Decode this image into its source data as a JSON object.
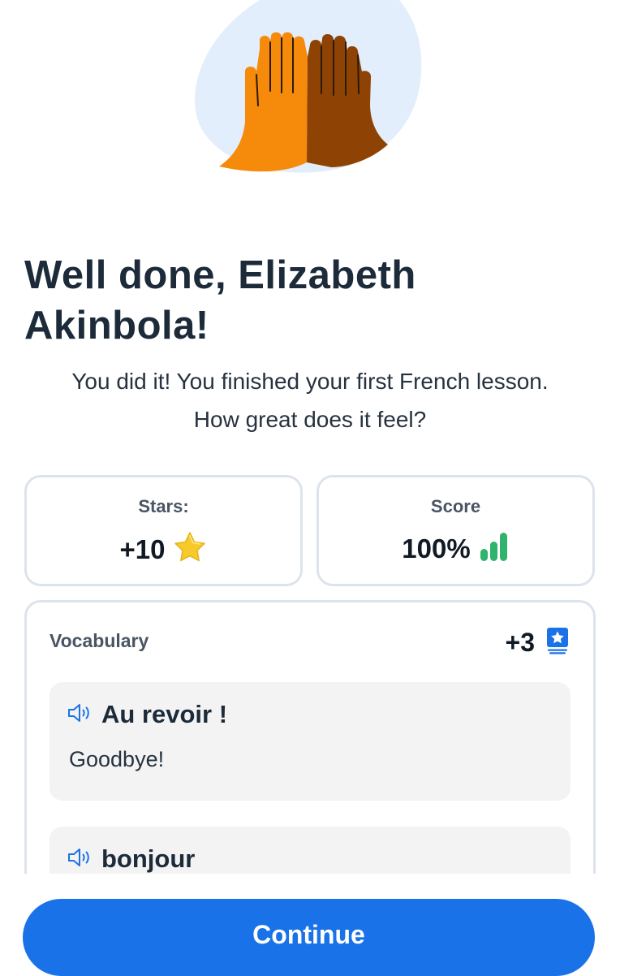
{
  "header": {
    "title": "Well done, Elizabeth Akinbola!",
    "subtitle": "You did it! You finished your first French lesson. How great does it feel?"
  },
  "stats": {
    "stars": {
      "label": "Stars:",
      "value": "+10",
      "icon": "star-icon",
      "icon_color": "#f7c92b"
    },
    "score": {
      "label": "Score",
      "value": "100%",
      "icon": "signal-bars-icon",
      "icon_color": "#2fb36d"
    }
  },
  "vocabulary": {
    "title": "Vocabulary",
    "count": "+3",
    "count_icon": "flashcards-star-icon",
    "items": [
      {
        "word": "Au revoir !",
        "translation": "Goodbye!",
        "icon": "speaker-icon"
      },
      {
        "word": "bonjour",
        "icon": "speaker-icon"
      }
    ]
  },
  "actions": {
    "continue_label": "Continue"
  },
  "colors": {
    "accent": "#1a72e8",
    "title": "#1c2a3a",
    "card_border": "#dde3ec",
    "word_card_bg": "#f3f3f3",
    "hand_left": "#f58a0b",
    "hand_right": "#8e4305",
    "blob": "#e3eefc"
  }
}
